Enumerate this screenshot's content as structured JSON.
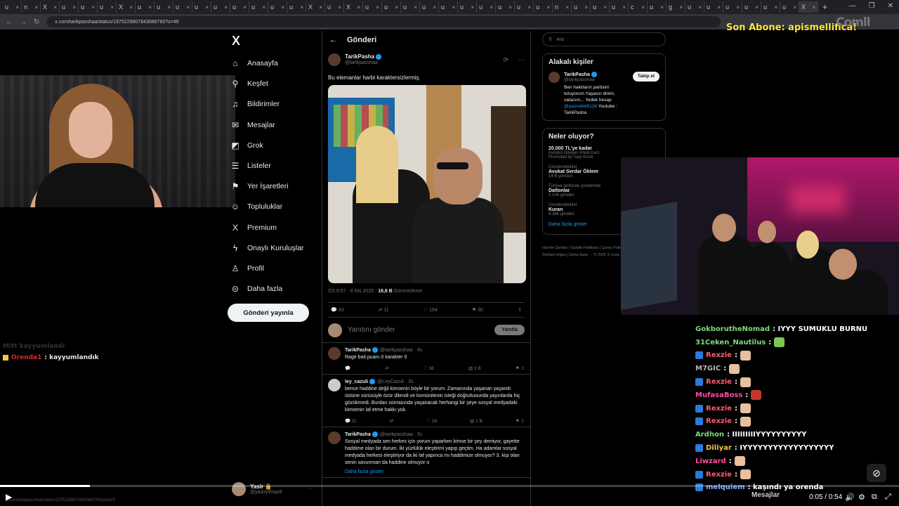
{
  "browser": {
    "tabs": [
      "u",
      "n",
      "X",
      "u",
      "u",
      "u",
      "X",
      "u",
      "u",
      "u",
      "u",
      "u",
      "u",
      "u",
      "u",
      "u",
      "X",
      "u",
      "X",
      "u",
      "u",
      "u",
      "u",
      "u",
      "u",
      "u",
      "u",
      "u",
      "u",
      "n",
      "u",
      "u",
      "u",
      "c",
      "u",
      "g",
      "u",
      "u",
      "u",
      "u",
      "u",
      "u",
      "X"
    ],
    "active_tab": "X",
    "new_tab": "+",
    "url": "x.com/tarikpasshaa/status/1975228807843086780?s=46"
  },
  "overlay": {
    "sub_banner": "Son Abone: apismellifica!",
    "logo": "Comll"
  },
  "x_sidebar": {
    "logo": "X",
    "items": [
      {
        "label": "Anasayfa",
        "icon": "home-icon",
        "glyph": "⌂"
      },
      {
        "label": "Keşfet",
        "icon": "search-icon",
        "glyph": "⚲"
      },
      {
        "label": "Bildirimler",
        "icon": "bell-icon",
        "glyph": "♫"
      },
      {
        "label": "Mesajlar",
        "icon": "mail-icon",
        "glyph": "✉"
      },
      {
        "label": "Grok",
        "icon": "grok-icon",
        "glyph": "◩"
      },
      {
        "label": "Listeler",
        "icon": "list-icon",
        "glyph": "☰"
      },
      {
        "label": "Yer İşaretleri",
        "icon": "bookmark-icon",
        "glyph": "⚑"
      },
      {
        "label": "Topluluklar",
        "icon": "people-icon",
        "glyph": "☺"
      },
      {
        "label": "Premium",
        "icon": "x-premium-icon",
        "glyph": "X"
      },
      {
        "label": "Onaylı Kuruluşlar",
        "icon": "lightning-icon",
        "glyph": "ϟ"
      },
      {
        "label": "Profil",
        "icon": "profile-icon",
        "glyph": "♙"
      },
      {
        "label": "Daha fazla",
        "icon": "more-circle-icon",
        "glyph": "⊝"
      }
    ],
    "post_button": "Gönderi yayınla",
    "account": {
      "name": "Yasir 🔒",
      "handle": "@yasiryilmaz8",
      "more": "···"
    }
  },
  "main": {
    "header": "Gönderi",
    "tweet": {
      "name": "TarikPasha",
      "handle": "@tarikpasshaa",
      "text": "Bu elemanlar harbi karaktersizlermiş.",
      "time": "ÖS 6:57 · 8 Eki 2025 · ",
      "views": "16,6 B",
      "views_label": " Görüntüleme",
      "stats": {
        "replies": "33",
        "retweets": "11",
        "likes": "164",
        "bookmarks": "30"
      }
    },
    "reply_box": {
      "placeholder": "Yanıtını gönder",
      "button": "Yanıtla"
    },
    "replies": [
      {
        "name": "TarikPasha",
        "meta": "@tarikpasshaa · 4s",
        "text": "Rage bait puanı 0 karakter 0",
        "stats": [
          "",
          "",
          "38",
          "3 B"
        ]
      },
      {
        "name": "ley_cazuli",
        "meta": "@LeyCazuli · 3s",
        "text": "bence haddine değil kimsenin böyle bir yorum. Zamanında yaşanan yaşandı üstüne sürüsüyle özür dilendi ve komünitenin isteği doğrultusunda yayınlarda hiç gözükmedi. Burdan sonrasında yaşanacak herhangi bir şeye sosyal medyadaki kimsenin laf etme hakkı yok.",
        "stats": [
          "11",
          "",
          "28",
          "1 B"
        ]
      },
      {
        "name": "TarikPasha",
        "meta": "@tarikpasshaa · 3s",
        "text": "Sosyal medyada sen herkes için yorum yaparken kimse bir şey demiyor, gayette haddime olan bir durum. İki yüzlülük eleştirimi yapıp geçtim. Ha adamlar sosyal medyada herkesi eleştiriyor da iki laf yapınca mı haddimize olmuyor? 3. kişi olan senin savunman da haddine olmuyor o",
        "more": "Daha fazla göster"
      }
    ]
  },
  "right": {
    "search_placeholder": "Ara",
    "related_title": "Alakalı kişiler",
    "related": {
      "name": "TarikPasha",
      "handle": "@tarikpasshaa",
      "follow": "Takip et",
      "bio": "Ben haklıların partisini tutuyorum Yaşasın dinim, vatanım... Yedek hesap ",
      "bio_link": "@pasnaliet6136",
      "bio_tail": " Youtube : TarikPasha"
    },
    "trends_title": "Neler oluyor?",
    "trends": [
      {
        "ctx": "",
        "title": "20.000 TL'ye kadar",
        "count": "Kendini Ödeyen Kredi Kartı",
        "promo": "Promoted by Yapı Kredi"
      },
      {
        "ctx": "Gündemdekiler",
        "title": "Avukat Serdar Öktem",
        "count": "14 B gönderi"
      },
      {
        "ctx": "Türkiye tarihinde gündemde",
        "title": "Daltonlar",
        "count": "1.106 gönderi"
      },
      {
        "ctx": "Gündemdekiler",
        "title": "Kuran",
        "count": "6.366 gönderi"
      }
    ],
    "show_more": "Daha fazla göster",
    "footer": "Hizmet Şartları | Gizlilik Politikası | Çerez Politikası | Erişilebilirlik | Reklam bilgisi | Daha fazla ··· © 2025 X Corp."
  },
  "chat": {
    "messages": [
      {
        "user": "GokborutheNomad",
        "color": "#7ddc7d",
        "text": " : IYYY SUMUKLU BURNU",
        "badge": false,
        "emote": null
      },
      {
        "user": "31Ceken_Nautilus",
        "color": "#7ddc7d",
        "text": " : ",
        "badge": false,
        "emote": "green"
      },
      {
        "user": "Rexzie",
        "color": "#ff5a6e",
        "text": " : ",
        "badge": true,
        "emote": "face"
      },
      {
        "user": "M7GIC",
        "color": "#b9b9b9",
        "text": " : ",
        "badge": false,
        "emote": "face"
      },
      {
        "user": "Rexzie",
        "color": "#ff5a6e",
        "text": " : ",
        "badge": true,
        "emote": "face"
      },
      {
        "user": "MufasaBoss",
        "color": "#ff4fa0",
        "text": " : ",
        "badge": false,
        "emote": "red"
      },
      {
        "user": "Rexzie",
        "color": "#ff5a6e",
        "text": " : ",
        "badge": true,
        "emote": "face"
      },
      {
        "user": "Rexzie",
        "color": "#ff5a6e",
        "text": " : ",
        "badge": true,
        "emote": "face"
      },
      {
        "user": "Ardhon",
        "color": "#7ddc7d",
        "text": " : IIIIIIIIIYYYYYYYYYY",
        "badge": false,
        "emote": null
      },
      {
        "user": "Diliyar",
        "color": "#f2c744",
        "text": " : IYYYYYYYYYYYYYYYYYY",
        "badge": true,
        "emote": null
      },
      {
        "user": "Liwzard",
        "color": "#ff4fa0",
        "text": " : ",
        "badge": false,
        "emote": "face"
      },
      {
        "user": "Rexzie",
        "color": "#ff5a6e",
        "text": " : ",
        "badge": true,
        "emote": "face"
      },
      {
        "user": "melquiem",
        "color": "#7aa7ff",
        "text": " : kaşındı ya orenda",
        "badge": true,
        "emote": null
      }
    ],
    "left": {
      "faded": "Mitt kayyumlandı",
      "user": "Orenda1",
      "text": " : kayyumlandık"
    },
    "panel_label": "Mesajlar"
  },
  "player": {
    "progress": 0.1,
    "time": "0:05 / 0:54",
    "play_icon": "▶",
    "status_url": "x.com/tarikpasshaa/status/1975228807843086780/photo/1"
  },
  "colors": {
    "background": "#000000",
    "x_text": "#e7e9ea",
    "x_muted": "#71767b",
    "x_blue": "#1d9bf0",
    "sub_banner": "#ffe74a"
  }
}
